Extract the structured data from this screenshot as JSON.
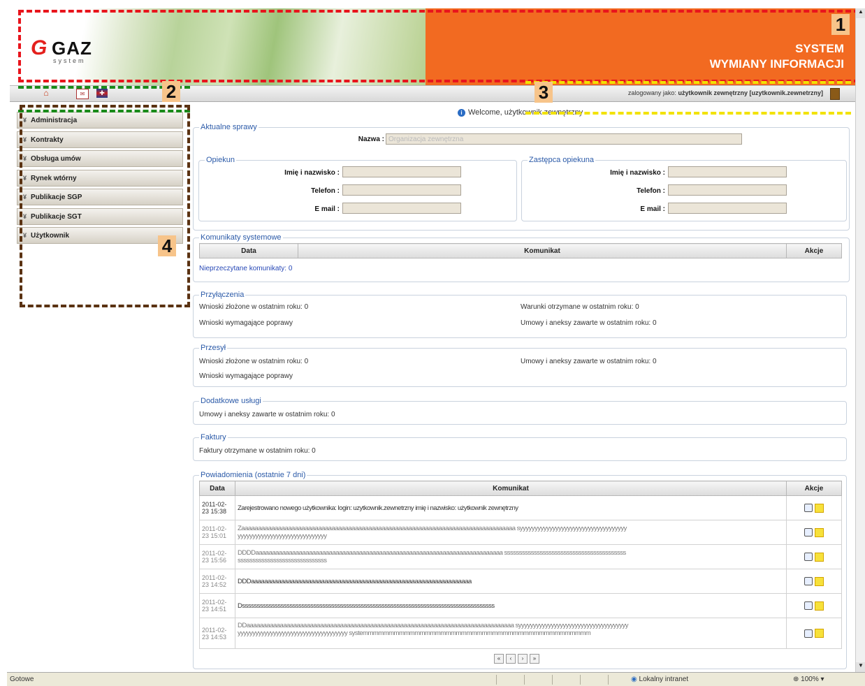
{
  "header": {
    "logo_mark": "G",
    "logo_text": "GAZ",
    "logo_sub": "system",
    "title_line1": "SYSTEM",
    "title_line2": "WYMIANY INFORMACJI"
  },
  "toolbar": {
    "user_prefix": "zalogowany jako:",
    "user_name": "użytkownik zewnętrzny [uzytkownik.zewnetrzny]"
  },
  "annotations": [
    "1",
    "2",
    "3",
    "4"
  ],
  "sidebar": {
    "items": [
      {
        "label": "Administracja"
      },
      {
        "label": "Kontrakty"
      },
      {
        "label": "Obsługa umów"
      },
      {
        "label": "Rynek wtórny"
      },
      {
        "label": "Publikacje SGP"
      },
      {
        "label": "Publikacje SGT"
      },
      {
        "label": "Użytkownik"
      }
    ]
  },
  "welcome": "Welcome, użytkownik zewnętrzny",
  "aktualne": {
    "legend": "Aktualne sprawy",
    "nazwa_label": "Nazwa :",
    "nazwa_value": "Organizacja zewnętrzna"
  },
  "opiekun": {
    "legend": "Opiekun",
    "name_label": "Imię i nazwisko :",
    "phone_label": "Telefon :",
    "email_label": "E mail :"
  },
  "zastepca": {
    "legend": "Zastępca opiekuna",
    "name_label": "Imię i nazwisko :",
    "phone_label": "Telefon :",
    "email_label": "E mail :"
  },
  "komunikaty": {
    "legend": "Komunikaty systemowe",
    "col_date": "Data",
    "col_msg": "Komunikat",
    "col_act": "Akcje",
    "unread": "Nieprzeczytane komunikaty: 0"
  },
  "przylaczenia": {
    "legend": "Przyłączenia",
    "left1": "Wnioski złożone w ostatnim roku: 0",
    "left2": "Wnioski wymagające poprawy",
    "right1": "Warunki otrzymane w ostatnim roku: 0",
    "right2": "Umowy i aneksy zawarte w ostatnim roku: 0"
  },
  "przesyl": {
    "legend": "Przesył",
    "left1": "Wnioski złożone w ostatnim roku: 0",
    "left2": "Wnioski wymagające poprawy",
    "right1": "Umowy i aneksy zawarte w ostatnim roku: 0"
  },
  "dodatkowe": {
    "legend": "Dodatkowe usługi",
    "line1": "Umowy i aneksy zawarte w ostatnim roku: 0"
  },
  "faktury": {
    "legend": "Faktury",
    "line1": "Faktury otrzymane w ostatnim roku: 0"
  },
  "powiadomienia": {
    "legend": "Powiadomienia (ostatnie 7 dni)",
    "col_date": "Data",
    "col_msg": "Komunikat",
    "col_act": "Akcje",
    "rows": [
      {
        "date": "2011-02-23 15:38",
        "msg": "Zarejestrowano nowego użytkownika: login: uzytkownik.zewnetrzny imię i nazwisko: użytkownik zewnętrzny"
      },
      {
        "date": "2011-02-23 15:01",
        "msg": "Zaaaaaaaaaaaaaaaaaaaaaaaaaaaaaaaaaaaaaaaaaaaaaaaaaaaaaaaaaaaaaaaaaaaaaaaaaaaaaaaaaa syyyyyyyyyyyyyyyyyyyyyyyyyyyyyyyyyyyyyyyyyyyyyyyyyyyyyyyyyyyyyyyyyy"
      },
      {
        "date": "2011-02-23 15:56",
        "msg": "DDDDaaaaaaaaaaaaaaaaaaaaaaaaaaaaaaaaaaaaaaaaaaaaaaaaaaaaaaaaaaaaaaaaaaaaaaaaaa sssssssssssssssssssssssssssssssssssssssssssssssssssssssssssssssssssssss"
      },
      {
        "date": "2011-02-23 14:52",
        "msg": "DDDaaaaaaaaaaaaaaaaaaaaaaaaaaaaaaaaaaaaaaaaaaaaaaaaaaaaaaaaaaaaaaaaaa"
      },
      {
        "date": "2011-02-23 14:51",
        "msg": "Dsssssssssssssssssssssssssssssssssssssssssssssssssssssssssssssssssssssssssssssssssssss"
      },
      {
        "date": "2011-02-23 14:53",
        "msg": "DDaaaaaaaaaaaaaaaaaaaaaaaaaaaaaaaaaaaaaaaaaaaaaaaaaaaaaaaaaaaaaaaaaaaaaaaaaaaaaaaa syyyyyyyyyyyyyyyyyyyyyyyyyyyyyyyyyyyyyyyyyyyyyyyyyyyyyyyyyyyyyyyyyyyyyyyyyy systemmmmmmmmmmmmmmmmmmmmmmmmmmmmmmmmmmmmmmmmmmmm"
      }
    ]
  },
  "pager": [
    "«",
    "‹",
    "›",
    "»"
  ],
  "statusbar": {
    "ready": "Gotowe",
    "zone": "Lokalny intranet",
    "zoom": "100%"
  }
}
